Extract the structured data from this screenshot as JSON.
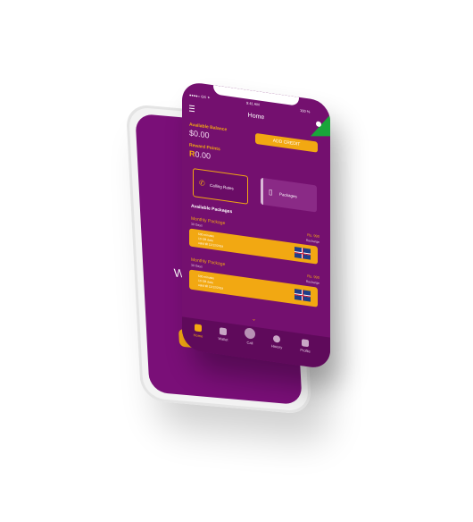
{
  "back_phone": {
    "welcome_text": "Welco"
  },
  "status_bar": {
    "carrier": "●●●●○ GS ✦",
    "time": "9:41 AM",
    "battery": "100 %"
  },
  "header": {
    "title": "Home"
  },
  "balance": {
    "label": "Available Balance",
    "value": "$0.00",
    "add_credit_label": "ADD CREDIT"
  },
  "reward": {
    "label": "Reward Points",
    "symbol": "R",
    "value": "0.00"
  },
  "tabs": [
    {
      "label": "Calling Rates",
      "icon": "phone-icon"
    },
    {
      "label": "Packages",
      "icon": "phone-outline-icon"
    }
  ],
  "available_packages_title": "Available Packages",
  "packages": [
    {
      "name": "Monthly Package",
      "days": "30 Days",
      "price": "Rs. 990",
      "tag": "Recharge",
      "line1": "500 minutes",
      "line2": "10 GB  data",
      "line3": "valid till 12/12/2019",
      "flag": "uk-flag"
    },
    {
      "name": "Monthly Package",
      "days": "30 Days",
      "price": "Rs. 990",
      "tag": "Recharge",
      "line1": "500 minutes",
      "line2": "10 GB  data",
      "line3": "valid till 12/12/2019",
      "flag": "uk-flag"
    }
  ],
  "more_chevron": "⌄",
  "bottom_nav": [
    {
      "label": "Home",
      "icon": "home-icon"
    },
    {
      "label": "Wallet",
      "icon": "wallet-icon"
    },
    {
      "label": "Call",
      "icon": "call-icon"
    },
    {
      "label": "History",
      "icon": "history-icon"
    },
    {
      "label": "Profile",
      "icon": "profile-icon"
    }
  ],
  "colors": {
    "primary": "#74106f",
    "accent": "#f2a812",
    "badge": "#19a53a"
  }
}
